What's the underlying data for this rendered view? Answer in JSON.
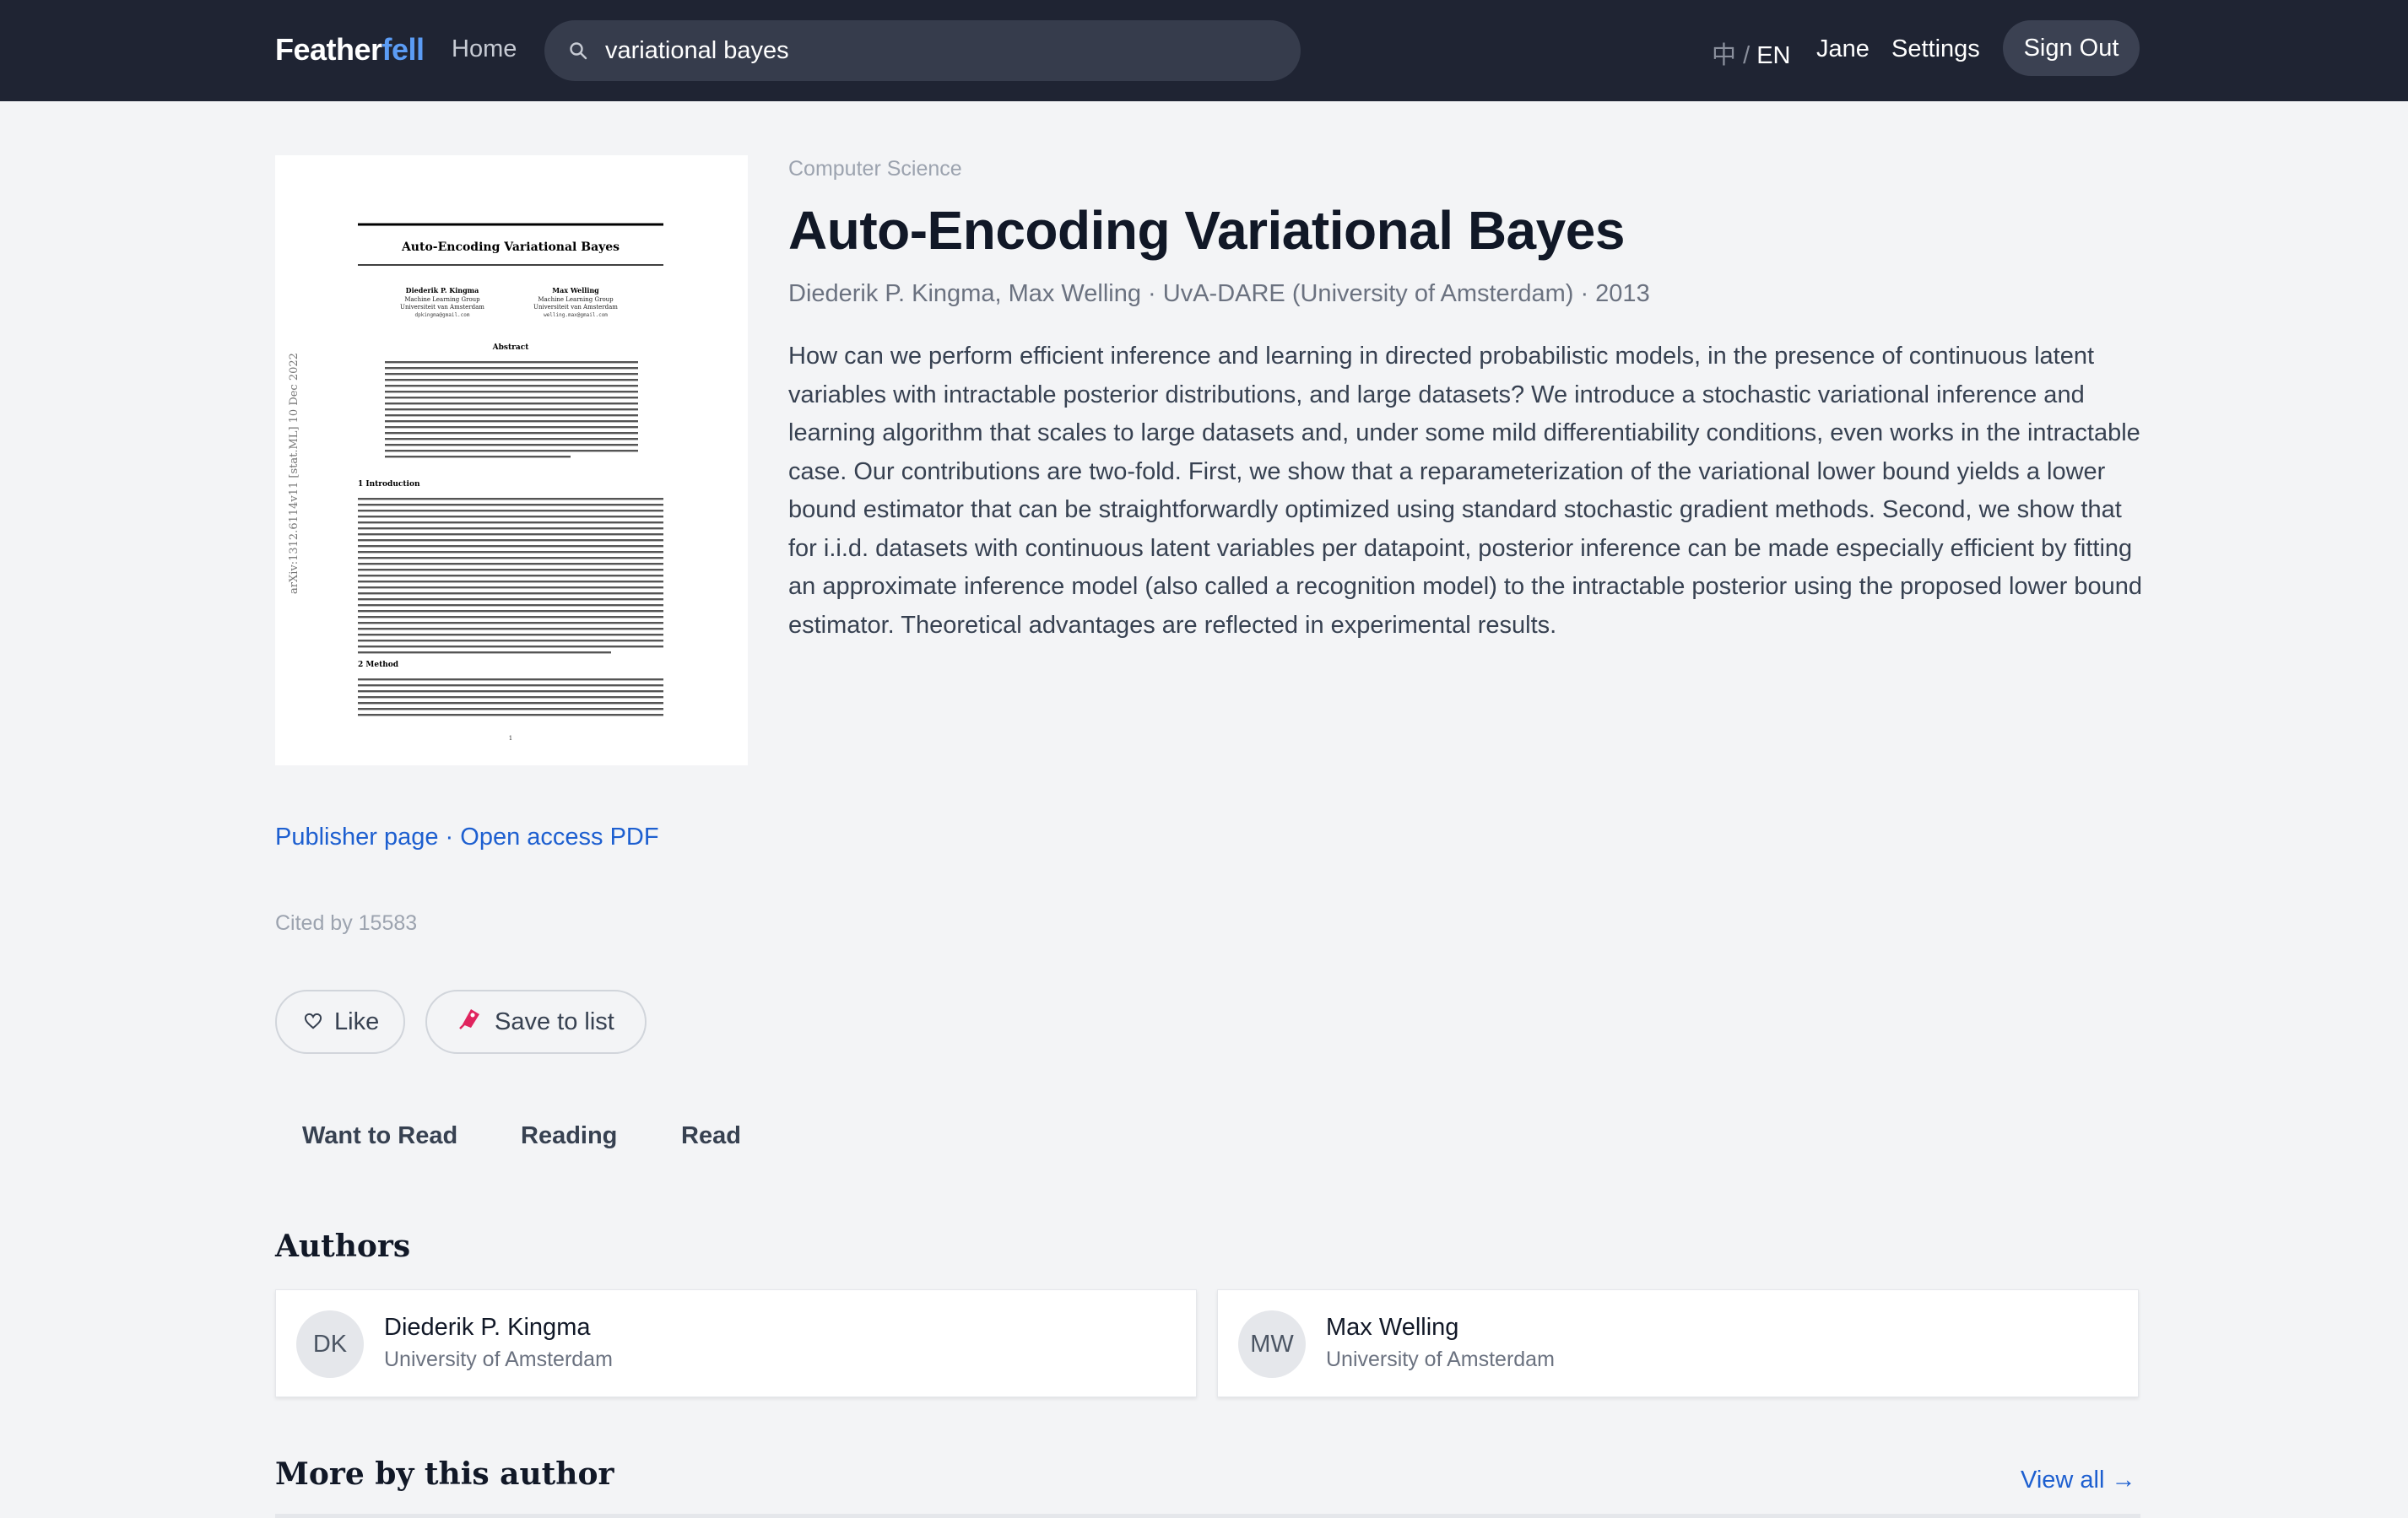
{
  "header": {
    "brand_main": "Feather",
    "brand_accent": "fell",
    "home_label": "Home",
    "search_value": "variational bayes",
    "lang_zh": "中",
    "lang_sep": "/",
    "lang_en": "EN",
    "user_name": "Jane",
    "settings_label": "Settings",
    "signout_label": "Sign Out"
  },
  "paper": {
    "category": "Computer Science",
    "title": "Auto-Encoding Variational Bayes",
    "meta": "Diederik P. Kingma, Max Welling · UvA-DARE (University of Amsterdam) · 2013",
    "abstract": "How can we perform efficient inference and learning in directed probabilistic models, in the presence of continuous latent variables with intractable posterior distributions, and large datasets? We introduce a stochastic variational inference and learning algorithm that scales to large datasets and, under some mild differentiability conditions, even works in the intractable case. Our contributions are two-fold. First, we show that a reparameterization of the variational lower bound yields a lower bound estimator that can be straightforwardly optimized using standard stochastic gradient methods. Second, we show that for i.i.d. datasets with continuous latent variables per datapoint, posterior inference can be made especially efficient by fitting an approximate inference model (also called a recognition model) to the intractable posterior using the proposed lower bound estimator. Theoretical advantages are reflected in experimental results.",
    "publisher_link": "Publisher page",
    "link_sep": " · ",
    "pdf_link": "Open access PDF",
    "cited_by": "Cited by 15583"
  },
  "cover": {
    "title": "Auto-Encoding Variational Bayes",
    "author1_name": "Diederik P. Kingma",
    "author1_group": "Machine Learning Group",
    "author1_univ": "Universiteit van Amsterdam",
    "author1_email": "dpkingma@gmail.com",
    "author2_name": "Max Welling",
    "author2_group": "Machine Learning Group",
    "author2_univ": "Universiteit van Amsterdam",
    "author2_email": "welling.max@gmail.com",
    "abstract_heading": "Abstract",
    "section1": "1    Introduction",
    "section2": "2    Method",
    "side_stamp": "arXiv:1312.6114v11  [stat.ML]  10 Dec 2022",
    "page_number": "1"
  },
  "actions": {
    "like_label": "Like",
    "like_icon": "heart-icon",
    "save_label": "Save to list",
    "save_icon": "bookmark-icon",
    "tabs": [
      "Want to Read",
      "Reading",
      "Read"
    ]
  },
  "authors_section": {
    "heading": "Authors",
    "items": [
      {
        "initials": "DK",
        "name": "Diederik P. Kingma",
        "affiliation": "University of Amsterdam"
      },
      {
        "initials": "MW",
        "name": "Max Welling",
        "affiliation": "University of Amsterdam"
      }
    ]
  },
  "more_section": {
    "heading": "More by this author",
    "view_all": "View all →"
  },
  "colors": {
    "header_bg": "#1f2433",
    "brand_accent": "#5b9cf5",
    "link": "#1d5fd0",
    "save_icon": "#e0245e"
  }
}
